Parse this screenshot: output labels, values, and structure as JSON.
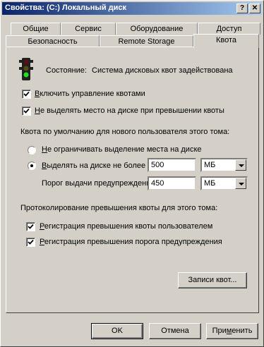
{
  "window": {
    "title": "Свойства: (C:) Локальный диск",
    "help_glyph": "?",
    "close_glyph": "✕"
  },
  "tabs": {
    "row_top": [
      "Общие",
      "Сервис",
      "Оборудование",
      "Доступ"
    ],
    "row_bottom": [
      "Безопасность",
      "Remote Storage",
      "Квота"
    ],
    "active": "Квота"
  },
  "quota": {
    "status_label": "Состояние:",
    "status_value": "Система дисковых квот задействована",
    "enable_quota": {
      "label_u": "В",
      "label_rest": "ключить управление квотами",
      "checked": true
    },
    "deny_space": {
      "label_u": "Н",
      "label_rest": "е выделять место на диске при превышении квоты",
      "checked": true
    },
    "default_limit_heading": "Квота по умолчанию для нового пользователя этого тома:",
    "no_limit": {
      "label_u": "Н",
      "label_rest": "е ограничивать выделение места на диске",
      "selected": false
    },
    "limit_to": {
      "label_u": "В",
      "label_rest": "ыделять на диске не более",
      "selected": true,
      "value": "500",
      "unit": "МБ"
    },
    "warning": {
      "label": "Порог выдачи предупреждений",
      "value": "450",
      "unit": "МБ"
    },
    "logging_heading": "Протоколирование превышения квоты для этого тома:",
    "log_quota": {
      "label_u": "Р",
      "label_rest": "егистрация превышения квоты пользователем",
      "checked": true
    },
    "log_warning": {
      "label_u": "Р",
      "label_rest": "егистрация превышения порога предупреждения",
      "checked": true
    },
    "entries_button": "Записи квот..."
  },
  "footer": {
    "ok": "OK",
    "cancel": "Отмена",
    "apply_pre": "При",
    "apply_u": "м",
    "apply_post": "енить"
  }
}
